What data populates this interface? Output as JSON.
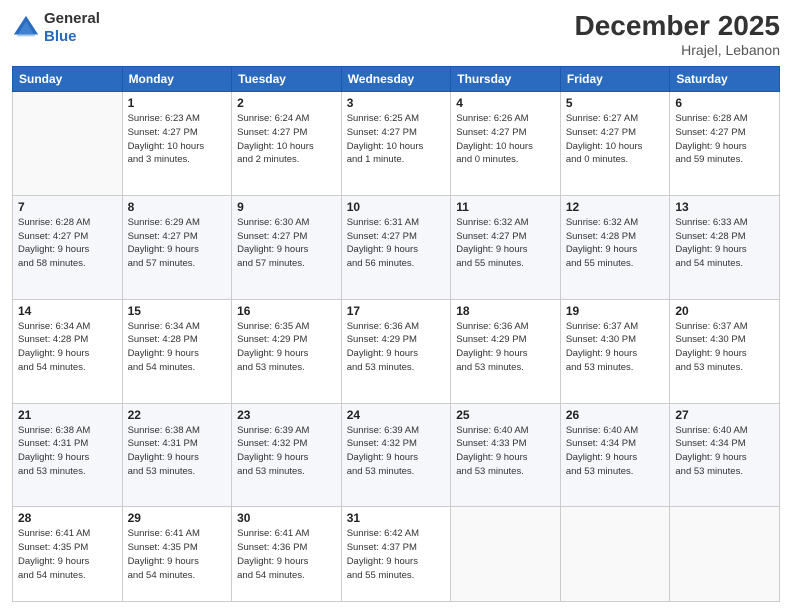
{
  "header": {
    "logo_general": "General",
    "logo_blue": "Blue",
    "month_title": "December 2025",
    "location": "Hrajel, Lebanon"
  },
  "weekdays": [
    "Sunday",
    "Monday",
    "Tuesday",
    "Wednesday",
    "Thursday",
    "Friday",
    "Saturday"
  ],
  "weeks": [
    [
      {
        "day": "",
        "info": ""
      },
      {
        "day": "1",
        "info": "Sunrise: 6:23 AM\nSunset: 4:27 PM\nDaylight: 10 hours\nand 3 minutes."
      },
      {
        "day": "2",
        "info": "Sunrise: 6:24 AM\nSunset: 4:27 PM\nDaylight: 10 hours\nand 2 minutes."
      },
      {
        "day": "3",
        "info": "Sunrise: 6:25 AM\nSunset: 4:27 PM\nDaylight: 10 hours\nand 1 minute."
      },
      {
        "day": "4",
        "info": "Sunrise: 6:26 AM\nSunset: 4:27 PM\nDaylight: 10 hours\nand 0 minutes."
      },
      {
        "day": "5",
        "info": "Sunrise: 6:27 AM\nSunset: 4:27 PM\nDaylight: 10 hours\nand 0 minutes."
      },
      {
        "day": "6",
        "info": "Sunrise: 6:28 AM\nSunset: 4:27 PM\nDaylight: 9 hours\nand 59 minutes."
      }
    ],
    [
      {
        "day": "7",
        "info": "Sunrise: 6:28 AM\nSunset: 4:27 PM\nDaylight: 9 hours\nand 58 minutes."
      },
      {
        "day": "8",
        "info": "Sunrise: 6:29 AM\nSunset: 4:27 PM\nDaylight: 9 hours\nand 57 minutes."
      },
      {
        "day": "9",
        "info": "Sunrise: 6:30 AM\nSunset: 4:27 PM\nDaylight: 9 hours\nand 57 minutes."
      },
      {
        "day": "10",
        "info": "Sunrise: 6:31 AM\nSunset: 4:27 PM\nDaylight: 9 hours\nand 56 minutes."
      },
      {
        "day": "11",
        "info": "Sunrise: 6:32 AM\nSunset: 4:27 PM\nDaylight: 9 hours\nand 55 minutes."
      },
      {
        "day": "12",
        "info": "Sunrise: 6:32 AM\nSunset: 4:28 PM\nDaylight: 9 hours\nand 55 minutes."
      },
      {
        "day": "13",
        "info": "Sunrise: 6:33 AM\nSunset: 4:28 PM\nDaylight: 9 hours\nand 54 minutes."
      }
    ],
    [
      {
        "day": "14",
        "info": "Sunrise: 6:34 AM\nSunset: 4:28 PM\nDaylight: 9 hours\nand 54 minutes."
      },
      {
        "day": "15",
        "info": "Sunrise: 6:34 AM\nSunset: 4:28 PM\nDaylight: 9 hours\nand 54 minutes."
      },
      {
        "day": "16",
        "info": "Sunrise: 6:35 AM\nSunset: 4:29 PM\nDaylight: 9 hours\nand 53 minutes."
      },
      {
        "day": "17",
        "info": "Sunrise: 6:36 AM\nSunset: 4:29 PM\nDaylight: 9 hours\nand 53 minutes."
      },
      {
        "day": "18",
        "info": "Sunrise: 6:36 AM\nSunset: 4:29 PM\nDaylight: 9 hours\nand 53 minutes."
      },
      {
        "day": "19",
        "info": "Sunrise: 6:37 AM\nSunset: 4:30 PM\nDaylight: 9 hours\nand 53 minutes."
      },
      {
        "day": "20",
        "info": "Sunrise: 6:37 AM\nSunset: 4:30 PM\nDaylight: 9 hours\nand 53 minutes."
      }
    ],
    [
      {
        "day": "21",
        "info": "Sunrise: 6:38 AM\nSunset: 4:31 PM\nDaylight: 9 hours\nand 53 minutes."
      },
      {
        "day": "22",
        "info": "Sunrise: 6:38 AM\nSunset: 4:31 PM\nDaylight: 9 hours\nand 53 minutes."
      },
      {
        "day": "23",
        "info": "Sunrise: 6:39 AM\nSunset: 4:32 PM\nDaylight: 9 hours\nand 53 minutes."
      },
      {
        "day": "24",
        "info": "Sunrise: 6:39 AM\nSunset: 4:32 PM\nDaylight: 9 hours\nand 53 minutes."
      },
      {
        "day": "25",
        "info": "Sunrise: 6:40 AM\nSunset: 4:33 PM\nDaylight: 9 hours\nand 53 minutes."
      },
      {
        "day": "26",
        "info": "Sunrise: 6:40 AM\nSunset: 4:34 PM\nDaylight: 9 hours\nand 53 minutes."
      },
      {
        "day": "27",
        "info": "Sunrise: 6:40 AM\nSunset: 4:34 PM\nDaylight: 9 hours\nand 53 minutes."
      }
    ],
    [
      {
        "day": "28",
        "info": "Sunrise: 6:41 AM\nSunset: 4:35 PM\nDaylight: 9 hours\nand 54 minutes."
      },
      {
        "day": "29",
        "info": "Sunrise: 6:41 AM\nSunset: 4:35 PM\nDaylight: 9 hours\nand 54 minutes."
      },
      {
        "day": "30",
        "info": "Sunrise: 6:41 AM\nSunset: 4:36 PM\nDaylight: 9 hours\nand 54 minutes."
      },
      {
        "day": "31",
        "info": "Sunrise: 6:42 AM\nSunset: 4:37 PM\nDaylight: 9 hours\nand 55 minutes."
      },
      {
        "day": "",
        "info": ""
      },
      {
        "day": "",
        "info": ""
      },
      {
        "day": "",
        "info": ""
      }
    ]
  ]
}
